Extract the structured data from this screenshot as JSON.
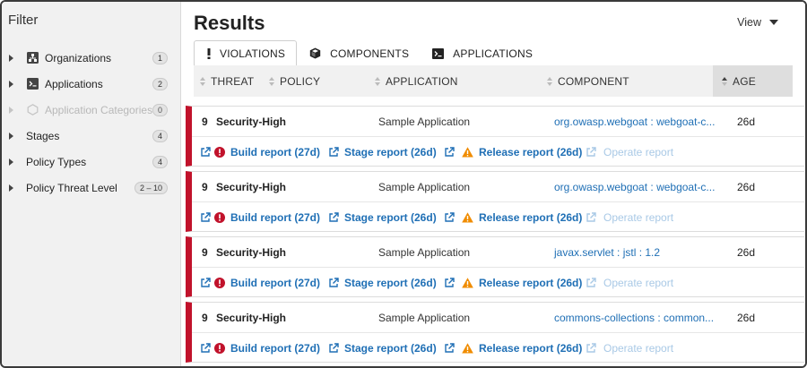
{
  "sidebar": {
    "title": "Filter",
    "items": [
      {
        "label": "Organizations",
        "count": "1",
        "icon": "organizations-icon",
        "disabled": false
      },
      {
        "label": "Applications",
        "count": "2",
        "icon": "terminal-icon",
        "disabled": false
      },
      {
        "label": "Application Categories",
        "count": "0",
        "icon": "hexagon-icon",
        "disabled": true
      },
      {
        "label": "Stages",
        "count": "4",
        "icon": "",
        "disabled": false
      },
      {
        "label": "Policy Types",
        "count": "4",
        "icon": "",
        "disabled": false
      },
      {
        "label": "Policy Threat Level",
        "count": "2 – 10",
        "icon": "",
        "disabled": false
      }
    ]
  },
  "main": {
    "title": "Results",
    "view_label": "View",
    "tabs": [
      {
        "label": "VIOLATIONS",
        "icon": "exclamation-icon",
        "active": true
      },
      {
        "label": "COMPONENTS",
        "icon": "cube-icon",
        "active": false
      },
      {
        "label": "APPLICATIONS",
        "icon": "terminal-icon",
        "active": false
      }
    ],
    "columns": {
      "threat": "THREAT",
      "policy": "POLICY",
      "application": "APPLICATION",
      "component": "COMPONENT",
      "age": "AGE"
    }
  },
  "rows": [
    {
      "threat": "9",
      "policy": "Security-High",
      "application": "Sample Application",
      "component": "org.owasp.webgoat : webgoat-c...",
      "age": "26d"
    },
    {
      "threat": "9",
      "policy": "Security-High",
      "application": "Sample Application",
      "component": "org.owasp.webgoat : webgoat-c...",
      "age": "26d"
    },
    {
      "threat": "9",
      "policy": "Security-High",
      "application": "Sample Application",
      "component": "javax.servlet : jstl : 1.2",
      "age": "26d"
    },
    {
      "threat": "9",
      "policy": "Security-High",
      "application": "Sample Application",
      "component": "commons-collections : common...",
      "age": "26d"
    }
  ],
  "reports": {
    "build": "Build report (27d)",
    "stage": "Stage report (26d)",
    "release": "Release report (26d)",
    "operate": "Operate report"
  },
  "colors": {
    "threat_bar": "#c1122b",
    "link": "#1f6fb5",
    "error": "#c1122b",
    "warning": "#f08c00"
  }
}
